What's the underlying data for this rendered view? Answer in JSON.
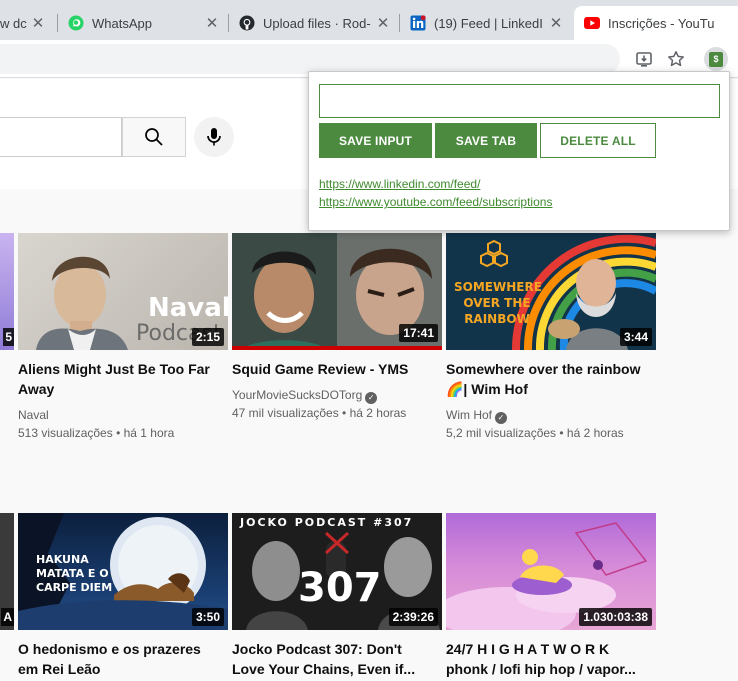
{
  "browser": {
    "tabs": [
      {
        "title": "w dc",
        "favicon": "generic",
        "active": false
      },
      {
        "title": "WhatsApp",
        "favicon": "whatsapp-icon",
        "active": false
      },
      {
        "title": "Upload files · Rod-",
        "favicon": "github-icon",
        "active": false
      },
      {
        "title": "(19) Feed | LinkedI",
        "favicon": "linkedin-icon",
        "active": false
      },
      {
        "title": "Inscrições - YouTu",
        "favicon": "youtube-icon",
        "active": true
      }
    ],
    "close_glyph": "✕",
    "extension_label": "$"
  },
  "popup": {
    "input_value": "",
    "buttons": {
      "save_input": "SAVE INPUT",
      "save_tab": "SAVE TAB",
      "delete_all": "DELETE ALL"
    },
    "links": [
      "https://www.linkedin.com/feed/",
      "https://www.youtube.com/feed/subscriptions"
    ],
    "accent_color": "#4c8a40"
  },
  "videos": [
    {
      "title": "Aliens Might Just Be Too Far Away",
      "channel": "Naval",
      "verified": false,
      "views": "513 visualizações",
      "age": "há 1 hora",
      "duration": "2:15",
      "thumb_text": [
        "Naval",
        "Podcast"
      ]
    },
    {
      "title": "Squid Game Review - YMS",
      "channel": "YourMovieSucksDOTorg",
      "verified": true,
      "views": "47 mil visualizações",
      "age": "há 2 horas",
      "duration": "17:41",
      "thumb_text": []
    },
    {
      "title": "Somewhere over the rainbow 🌈| Wim Hof",
      "channel": "Wim Hof",
      "verified": true,
      "views": "5,2 mil visualizações",
      "age": "há 2 horas",
      "duration": "3:44",
      "thumb_text": [
        "SOMEWHERE",
        "OVER THE",
        "RAINBOW"
      ]
    },
    {
      "title": "O hedonismo e os prazeres em Rei Leão",
      "duration": "3:50",
      "thumb_text": [
        "HAKUNA",
        "MATATA E O",
        "CARPE DIEM"
      ]
    },
    {
      "title": "Jocko Podcast 307: Don't Love Your Chains, Even if...",
      "duration": "2:39:26",
      "thumb_text": [
        "JOCKO PODCAST #307",
        "307"
      ]
    },
    {
      "title": "24/7 H I G H A T W O R K phonk / lofi hip hop / vapor...",
      "duration": "1.030:03:38",
      "thumb_text": []
    }
  ],
  "partial_durations": [
    "5",
    "A"
  ]
}
